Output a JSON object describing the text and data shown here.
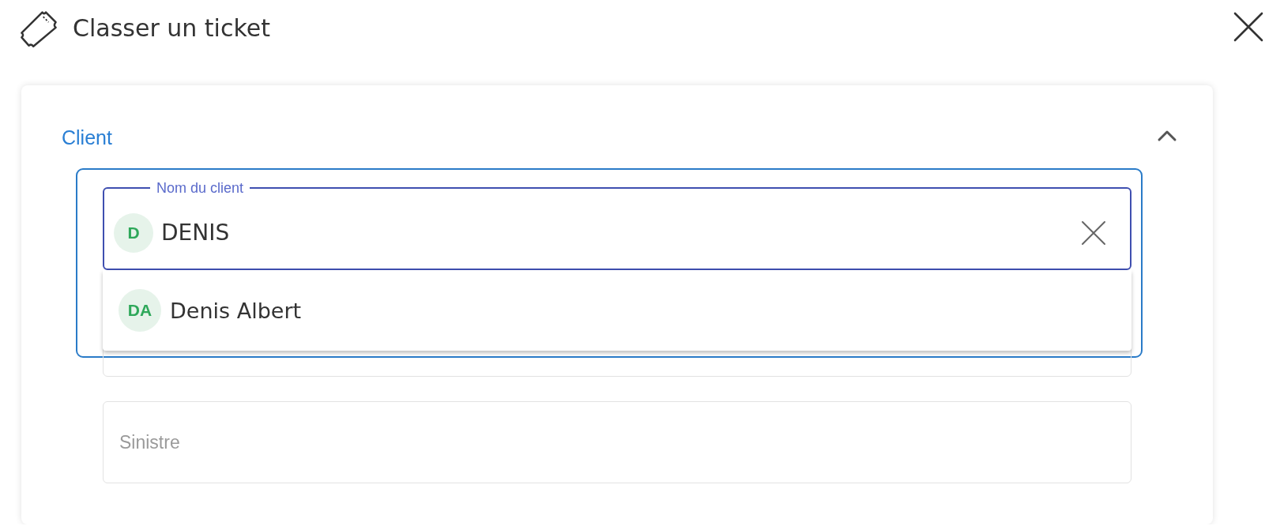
{
  "dialog": {
    "title": "Classer un ticket"
  },
  "section": {
    "title": "Client",
    "expanded": true
  },
  "client_field": {
    "label": "Nom du client",
    "value": "DENIS",
    "avatar": "D",
    "focused": true
  },
  "suggestions": [
    {
      "initials": "DA",
      "name": "Denis Albert",
      "selected": false
    }
  ],
  "claim_field": {
    "placeholder": "Sinistre"
  }
}
